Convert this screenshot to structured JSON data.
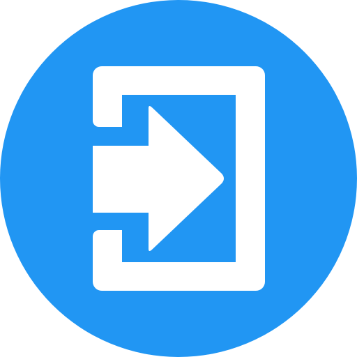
{
  "icon": {
    "name": "login-icon",
    "background_color": "#2196F3",
    "foreground_color": "#FFFFFF"
  }
}
